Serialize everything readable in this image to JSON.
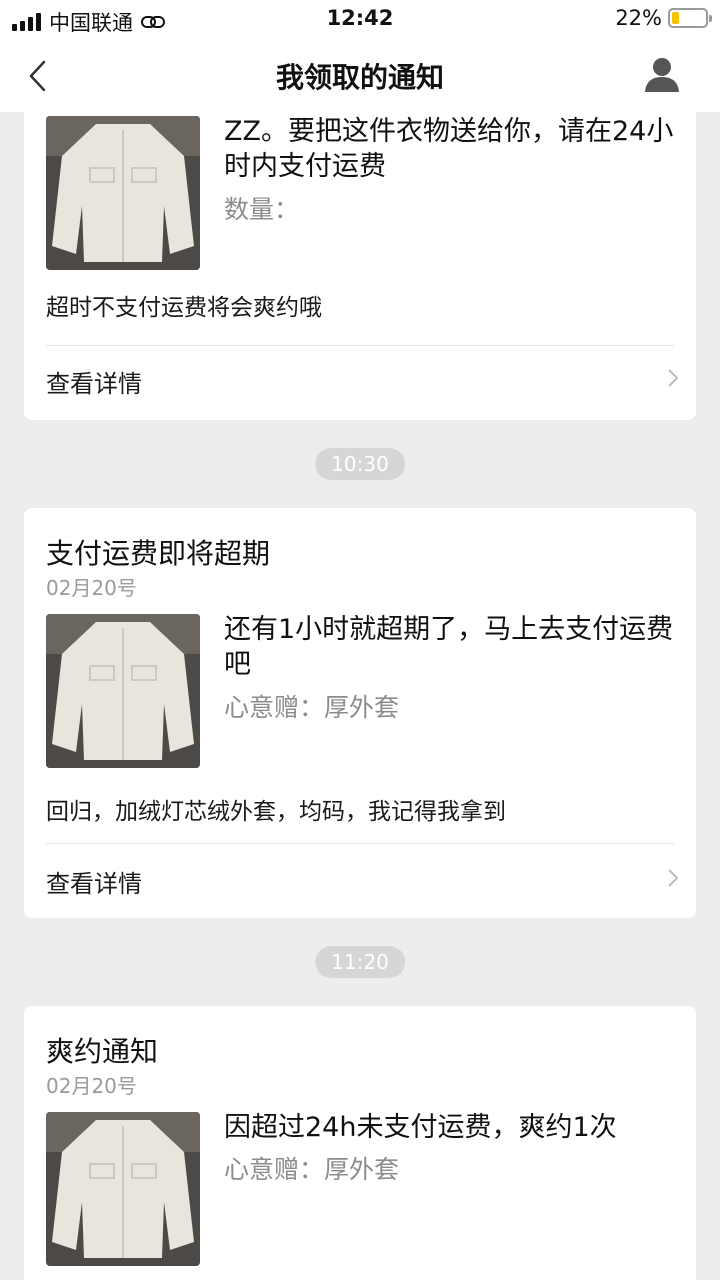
{
  "status_bar": {
    "carrier": "中国联通",
    "time": "12:42",
    "battery": "22%",
    "battery_level": 0.22
  },
  "nav": {
    "title": "我领取的通知",
    "back_icon": "chevron-left-icon",
    "user_icon": "user-icon"
  },
  "cards": [
    {
      "message": "ZZ。要把这件衣物送给你，请在24小时内支付运费",
      "subline": "数量：",
      "description": "超时不支付运费将会爽约哦",
      "detail_label": "查看详情"
    },
    {
      "time": "10:30",
      "title": "支付运费即将超期",
      "date": "02月20号",
      "message": "还有1小时就超期了，马上去支付运费吧",
      "subline": "心意赠：厚外套",
      "description": "回归，加绒灯芯绒外套，均码，我记得我拿到",
      "detail_label": "查看详情"
    },
    {
      "time": "11:20",
      "title": "爽约通知",
      "date": "02月20号",
      "message": "因超过24h未支付运费，爽约1次",
      "subline": "心意赠：厚外套"
    }
  ],
  "colors": {
    "background": "#ededed",
    "card": "#ffffff",
    "muted_text": "#9a9a9a",
    "time_pill": "#d6d6d6",
    "battery_fill": "#f5c400"
  }
}
